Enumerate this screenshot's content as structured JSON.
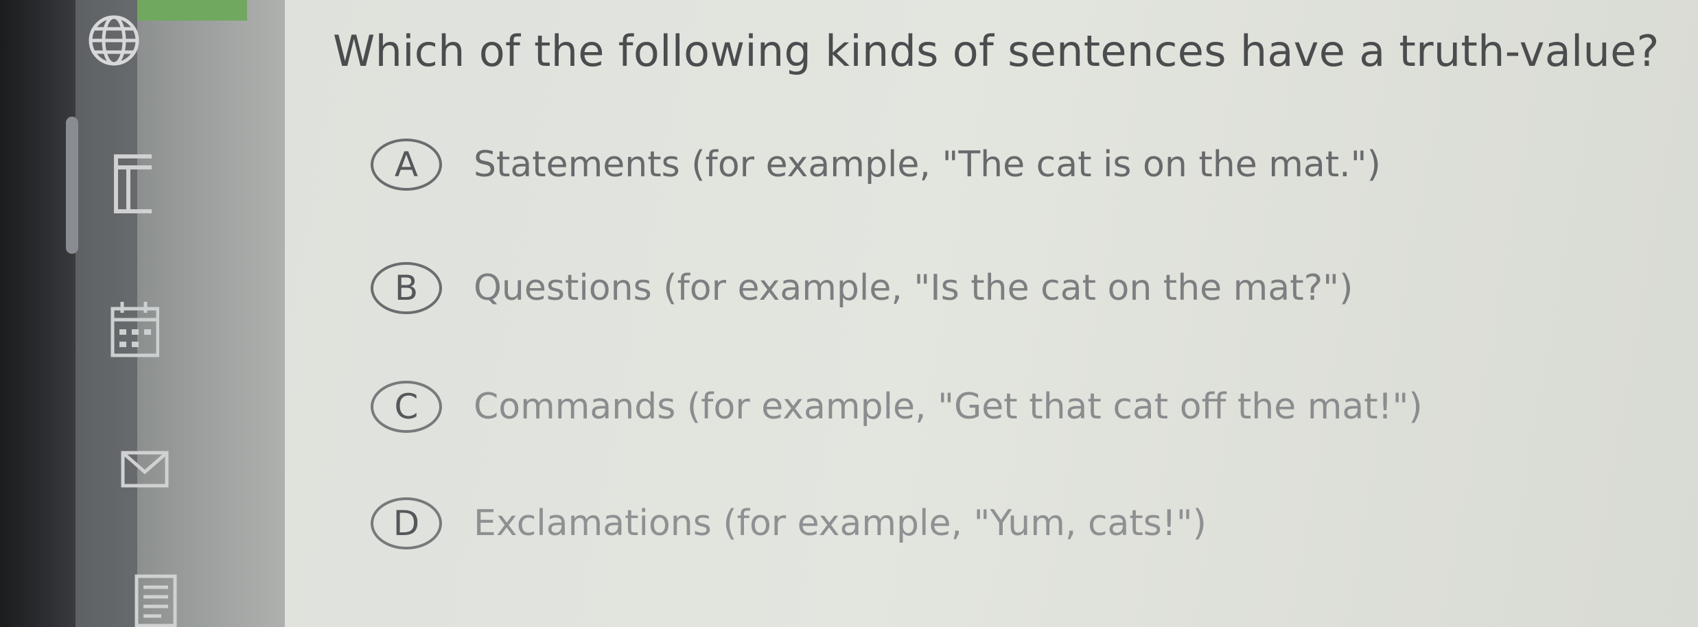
{
  "nav": {
    "items": [
      {
        "icon": "globe-icon"
      },
      {
        "icon": "document-icon"
      },
      {
        "icon": "calendar-icon"
      },
      {
        "icon": "mail-icon"
      },
      {
        "icon": "list-icon"
      }
    ]
  },
  "question": {
    "text": "Which of the following kinds of sentences have a truth-value?",
    "options": [
      {
        "letter": "A",
        "text": "Statements (for example, \"The cat is on the mat.\")"
      },
      {
        "letter": "B",
        "text": "Questions (for example, \"Is the cat on the mat?\")"
      },
      {
        "letter": "C",
        "text": "Commands (for example, \"Get that cat off the mat!\")"
      },
      {
        "letter": "D",
        "text": "Exclamations (for example, \"Yum, cats!\")"
      }
    ]
  }
}
